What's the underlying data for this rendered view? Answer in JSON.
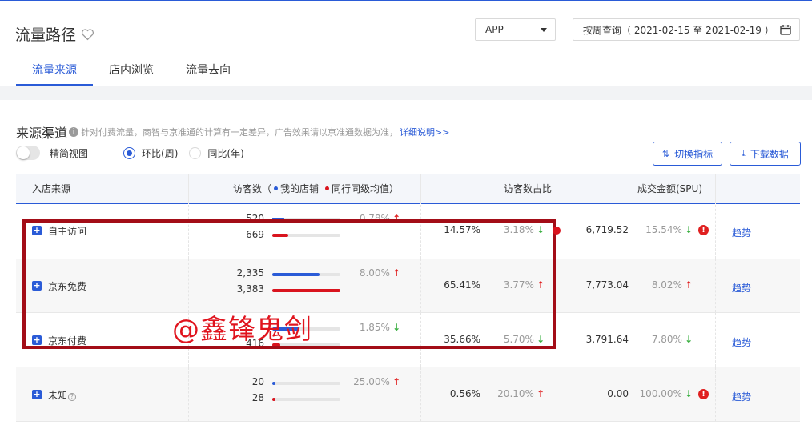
{
  "header": {
    "title": "流量路径",
    "platform_select": "APP",
    "date_range": "按周查询（ 2021-02-15 至 2021-02-19 ）",
    "tabs": [
      {
        "label": "流量来源",
        "active": true
      },
      {
        "label": "店内浏览",
        "active": false
      },
      {
        "label": "流量去向",
        "active": false
      }
    ]
  },
  "section": {
    "title": "来源渠道",
    "note": "针对付费流量，商智与京准通的计算有一定差异，广告效果请以京准通数据为准，",
    "detail_link": "详细说明>>",
    "toggle_label": "精简视图",
    "radio_week": "环比(周)",
    "radio_year": "同比(年)",
    "btn_switch": "切换指标",
    "btn_download": "下载数据"
  },
  "table": {
    "headers": {
      "source": "入店来源",
      "visitors": "访客数（",
      "legend_mine": "我的店铺",
      "legend_peer": "同行同级均值",
      "visitors_close": "）",
      "share": "访客数占比",
      "gmv": "成交金额(SPU)"
    },
    "rows": [
      {
        "name": "自主访问",
        "visitors_mine": "520",
        "visitors_peer": "669",
        "mine_frac": 0.18,
        "peer_frac": 0.23,
        "visitor_change": "0.78%",
        "visitor_dir": "up",
        "share": "14.57%",
        "share_change": "3.18%",
        "share_dir": "down",
        "gmv": "6,719.52",
        "gmv_change": "15.54%",
        "gmv_dir": "down",
        "warn": true,
        "trend": "趋势"
      },
      {
        "name": "京东免费",
        "visitors_mine": "2,335",
        "visitors_peer": "3,383",
        "mine_frac": 0.69,
        "peer_frac": 1.0,
        "visitor_change": "8.00%",
        "visitor_dir": "up",
        "share": "65.41%",
        "share_change": "3.77%",
        "share_dir": "up",
        "gmv": "7,773.04",
        "gmv_change": "8.02%",
        "gmv_dir": "up",
        "warn": false,
        "trend": "趋势"
      },
      {
        "name": "京东付费",
        "visitors_mine": "",
        "visitors_peer": "416",
        "mine_frac": 0.4,
        "peer_frac": 0.12,
        "visitor_change": "1.85%",
        "visitor_dir": "down",
        "share": "35.66%",
        "share_change": "5.70%",
        "share_dir": "down",
        "gmv": "3,791.64",
        "gmv_change": "7.80%",
        "gmv_dir": "down",
        "warn": false,
        "trend": "趋势"
      },
      {
        "name": "未知",
        "visitors_mine": "20",
        "visitors_peer": "28",
        "mine_frac": 0.01,
        "peer_frac": 0.01,
        "visitor_change": "25.00%",
        "visitor_dir": "up",
        "share": "0.56%",
        "share_change": "20.10%",
        "share_dir": "up",
        "gmv": "0.00",
        "gmv_change": "100.00%",
        "gmv_dir": "down",
        "warn": true,
        "trend": "趋势",
        "has_help": true
      }
    ]
  },
  "colors": {
    "accent": "#2a5bd7",
    "mine": "#2a5bd7",
    "peer": "#d9141e",
    "up": "#e02020",
    "down": "#3cb043",
    "highlight": "#a30d17"
  },
  "watermark": "@鑫锋鬼剑"
}
